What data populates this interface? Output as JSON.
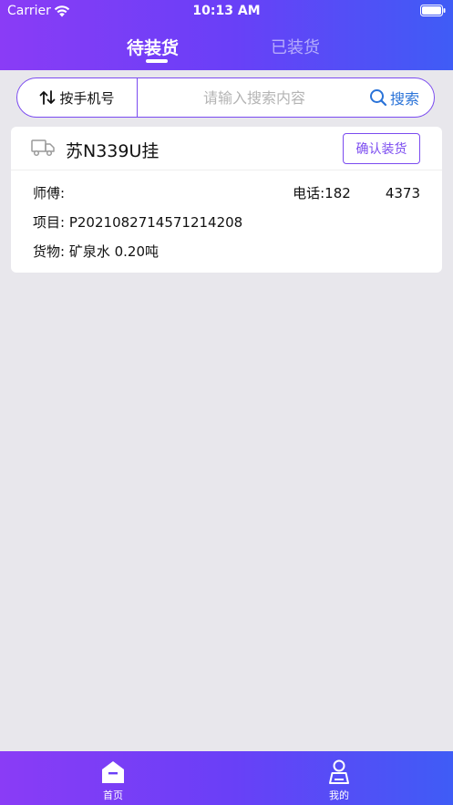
{
  "status_bar": {
    "carrier": "Carrier",
    "time": "10:13 AM"
  },
  "tabs": {
    "active": "待装货",
    "inactive": "已装货"
  },
  "search": {
    "sort_label": "按手机号",
    "placeholder": "请输入搜索内容",
    "button_label": "搜索"
  },
  "order": {
    "plate": "苏N339U挂",
    "confirm_label": "确认装货",
    "driver_label": "师傅:",
    "phone_label": "电话:",
    "phone_prefix": "182",
    "phone_suffix": "4373",
    "project_label": "项目:",
    "project_value": "P2021082714571214208",
    "goods_label": "货物:",
    "goods_value": "矿泉水 0.20吨"
  },
  "tabbar": {
    "home_label": "首页",
    "mine_label": "我的"
  },
  "colors": {
    "accent": "#7b4bf0",
    "gradient_start": "#8a3cf6",
    "gradient_end": "#3f5cf6",
    "search_blue": "#2a73d8"
  }
}
